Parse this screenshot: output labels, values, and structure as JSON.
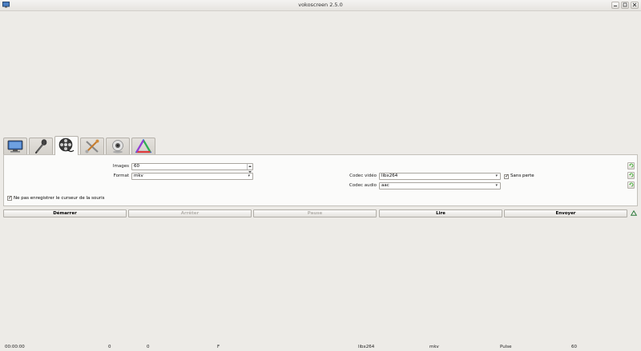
{
  "window": {
    "title": "vokoscreen 2.5.0"
  },
  "tabs": [
    {
      "icon": "monitor-icon",
      "active": false
    },
    {
      "icon": "microphone-icon",
      "active": false
    },
    {
      "icon": "film-reel-icon",
      "active": true
    },
    {
      "icon": "tools-icon",
      "active": false
    },
    {
      "icon": "webcam-icon",
      "active": false
    },
    {
      "icon": "rainbow-triangle-icon",
      "active": false
    }
  ],
  "video_settings": {
    "frames_label": "Images",
    "frames_value": "60",
    "format_label": "Format",
    "format_value": "mkv",
    "video_codec_label": "Codec vidéo",
    "video_codec_value": "libx264",
    "lossless_label": "Sans perte",
    "lossless_checked": true,
    "audio_codec_label": "Codec audio",
    "audio_codec_value": "aac",
    "no_cursor_label": "Ne pas enregistrer le curseur de la souris",
    "no_cursor_checked": true
  },
  "actions": {
    "start": "Démarrer",
    "stop": "Arrêter",
    "pause": "Pause",
    "play": "Lire",
    "send": "Envoyer"
  },
  "status_bar": {
    "time": "00:00:00",
    "value_a": "0",
    "value_b": "0",
    "value_c": "F",
    "codec": "libx264",
    "format": "mkv",
    "audio": "Pulse",
    "fps": "60"
  },
  "colors": {
    "window_bg": "#edebe7",
    "panel_bg": "#fbfbfa",
    "reset_icon": "#4caf3e"
  }
}
